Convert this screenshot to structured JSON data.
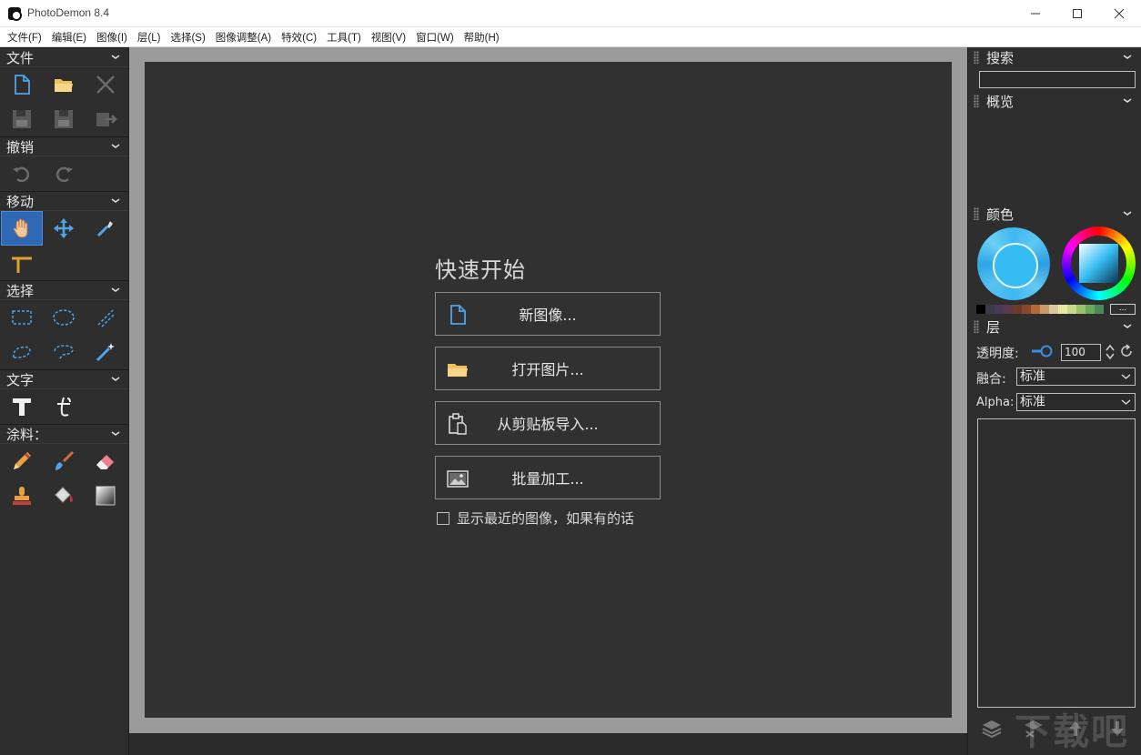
{
  "window": {
    "title": "PhotoDemon 8.4"
  },
  "menu": [
    "文件(F)",
    "编辑(E)",
    "图像(I)",
    "层(L)",
    "选择(S)",
    "图像调整(A)",
    "特效(C)",
    "工具(T)",
    "视图(V)",
    "窗口(W)",
    "帮助(H)"
  ],
  "toolbox": {
    "file": {
      "label": "文件",
      "tools": [
        "new-file-icon",
        "open-folder-icon",
        "close-icon",
        "save-icon",
        "save-as-icon",
        "export-icon"
      ]
    },
    "undo": {
      "label": "撤销",
      "tools": [
        "undo-icon",
        "redo-icon"
      ]
    },
    "move": {
      "label": "移动",
      "tools": [
        "hand-icon",
        "move-arrows-icon",
        "eyedropper-icon",
        "measure-icon"
      ]
    },
    "select": {
      "label": "选择",
      "tools": [
        "rect-select-icon",
        "ellipse-select-icon",
        "line-select-icon",
        "lasso-icon",
        "polygon-lasso-icon",
        "magic-wand-icon"
      ]
    },
    "text": {
      "label": "文字",
      "tools": [
        "text-icon",
        "typography-icon"
      ]
    },
    "paint": {
      "label": "涂料：",
      "tools": [
        "pencil-icon",
        "brush-icon",
        "eraser-icon",
        "clone-stamp-icon",
        "fill-bucket-icon",
        "gradient-icon"
      ]
    }
  },
  "quickstart": {
    "title": "快速开始",
    "new_image": "新图像...",
    "open_image": "打开图片...",
    "import_clipboard": "从剪贴板导入...",
    "batch": "批量加工...",
    "show_recent": "显示最近的图像，如果有的话",
    "show_recent_checked": false
  },
  "right_panel": {
    "search_label": "搜索",
    "search_value": "",
    "overview_label": "概览",
    "color_label": "颜色",
    "primary_color": "#35bdf3",
    "palette": [
      "#000000",
      "#3a3a4a",
      "#4a3a5a",
      "#5a3a4a",
      "#6b3a2a",
      "#8a4a2a",
      "#b06a3a",
      "#c89a6a",
      "#d8c89a",
      "#e8e8a0",
      "#c8d88a",
      "#9ac06a",
      "#6aa85a",
      "#4a8a5a"
    ],
    "palette_more": "...",
    "layer_label": "层",
    "opacity_label": "透明度:",
    "opacity_value": "100",
    "blend_label": "融合:",
    "blend_value": "标准",
    "alpha_label": "Alpha:",
    "alpha_value": "标准"
  },
  "watermark": "下载吧"
}
